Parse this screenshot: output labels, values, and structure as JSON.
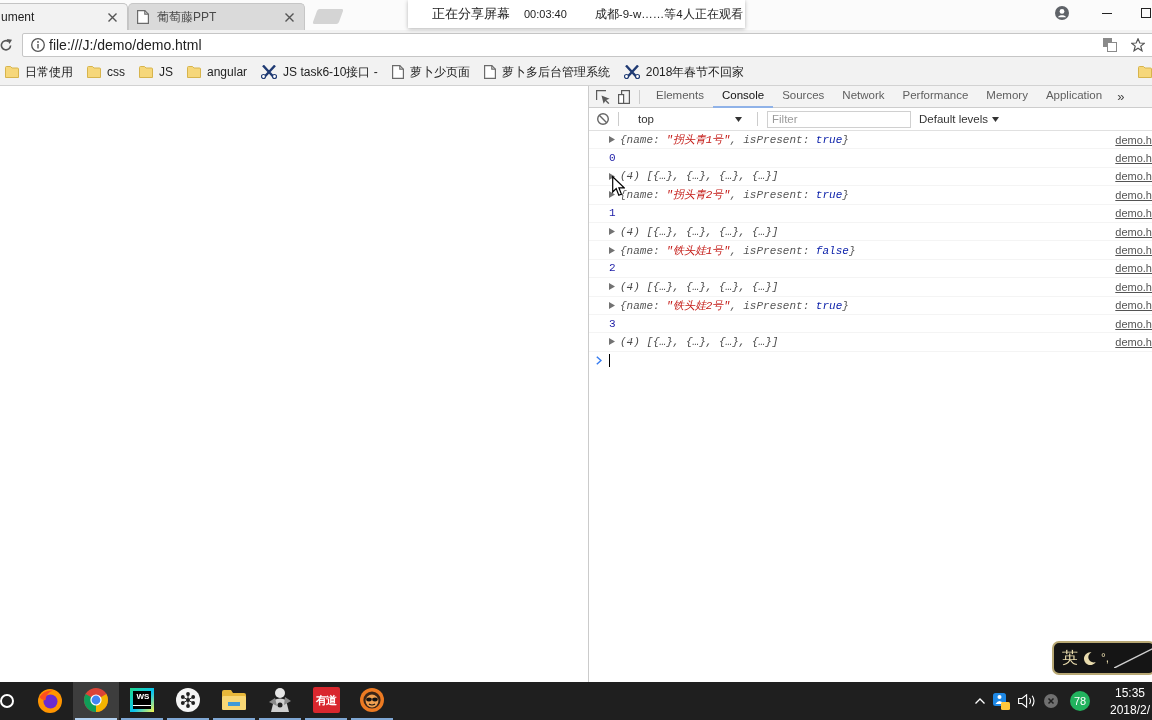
{
  "browser": {
    "tabs": [
      {
        "title": "ument",
        "selected": true
      },
      {
        "title": "葡萄藤PPT",
        "selected": false
      }
    ],
    "address_bar": {
      "value": "file:///J:/demo/demo.html"
    },
    "bookmarks": [
      {
        "kind": "folder",
        "label": "日常使用"
      },
      {
        "kind": "folder",
        "label": "css"
      },
      {
        "kind": "folder",
        "label": "JS"
      },
      {
        "kind": "folder",
        "label": "angular"
      },
      {
        "kind": "tool",
        "label": "JS task6-10接口 -"
      },
      {
        "kind": "page",
        "label": "萝卜少页面"
      },
      {
        "kind": "page",
        "label": "萝卜多后台管理系统"
      },
      {
        "kind": "tool",
        "label": "2018年春节不回家"
      }
    ]
  },
  "share_banner": {
    "status": "正在分享屏幕",
    "elapsed": "00:03:40",
    "viewers": "成都-9-w……等4人正在观看"
  },
  "devtools": {
    "tabs": [
      {
        "label": "Elements",
        "selected": false
      },
      {
        "label": "Console",
        "selected": true
      },
      {
        "label": "Sources",
        "selected": false
      },
      {
        "label": "Network",
        "selected": false
      },
      {
        "label": "Performance",
        "selected": false
      },
      {
        "label": "Memory",
        "selected": false
      },
      {
        "label": "Application",
        "selected": false
      }
    ],
    "more_tabs": "»",
    "console": {
      "context": "top",
      "filter": {
        "placeholder": "Filter"
      },
      "levels": "Default levels",
      "messages": [
        {
          "kind": "object",
          "segments": [
            {
              "kind": "punct",
              "text": "{name: "
            },
            {
              "kind": "string",
              "text": "\"拐头青1号\""
            },
            {
              "kind": "punct",
              "text": ", isPresent: "
            },
            {
              "kind": "boolean",
              "text": "true"
            },
            {
              "kind": "punct",
              "text": "}"
            }
          ],
          "source": "demo.h"
        },
        {
          "kind": "number",
          "segments": [
            {
              "kind": "number",
              "text": "0"
            }
          ],
          "source": "demo.h"
        },
        {
          "kind": "array",
          "segments": [
            {
              "kind": "preview",
              "text": "(4) [{…}, {…}, {…}, {…}]"
            }
          ],
          "source": "demo.h"
        },
        {
          "kind": "object",
          "segments": [
            {
              "kind": "punct",
              "text": "{name: "
            },
            {
              "kind": "string",
              "text": "\"拐头青2号\""
            },
            {
              "kind": "punct",
              "text": ", isPresent: "
            },
            {
              "kind": "boolean",
              "text": "true"
            },
            {
              "kind": "punct",
              "text": "}"
            }
          ],
          "source": "demo.h"
        },
        {
          "kind": "number",
          "segments": [
            {
              "kind": "number",
              "text": "1"
            }
          ],
          "source": "demo.h"
        },
        {
          "kind": "array",
          "segments": [
            {
              "kind": "preview",
              "text": "(4) [{…}, {…}, {…}, {…}]"
            }
          ],
          "source": "demo.h"
        },
        {
          "kind": "object",
          "segments": [
            {
              "kind": "punct",
              "text": "{name: "
            },
            {
              "kind": "string",
              "text": "\"铁头娃1号\""
            },
            {
              "kind": "punct",
              "text": ", isPresent: "
            },
            {
              "kind": "boolean",
              "text": "false"
            },
            {
              "kind": "punct",
              "text": "}"
            }
          ],
          "source": "demo.h"
        },
        {
          "kind": "number",
          "segments": [
            {
              "kind": "number",
              "text": "2"
            }
          ],
          "source": "demo.h"
        },
        {
          "kind": "array",
          "segments": [
            {
              "kind": "preview",
              "text": "(4) [{…}, {…}, {…}, {…}]"
            }
          ],
          "source": "demo.h"
        },
        {
          "kind": "object",
          "segments": [
            {
              "kind": "punct",
              "text": "{name: "
            },
            {
              "kind": "string",
              "text": "\"铁头娃2号\""
            },
            {
              "kind": "punct",
              "text": ", isPresent: "
            },
            {
              "kind": "boolean",
              "text": "true"
            },
            {
              "kind": "punct",
              "text": "}"
            }
          ],
          "source": "demo.h"
        },
        {
          "kind": "number",
          "segments": [
            {
              "kind": "number",
              "text": "3"
            }
          ],
          "source": "demo.h"
        },
        {
          "kind": "array",
          "segments": [
            {
              "kind": "preview",
              "text": "(4) [{…}, {…}, {…}, {…}]"
            }
          ],
          "source": "demo.h"
        }
      ]
    }
  },
  "ime": {
    "mode": "英",
    "punctuation": "°,"
  },
  "taskbar": {
    "apps": [
      {
        "kind": "globe",
        "running": false,
        "selected": false
      },
      {
        "kind": "ring_logo",
        "running": true,
        "selected": true
      },
      {
        "kind": "framed_tile",
        "label": "WS",
        "running": true,
        "selected": false
      },
      {
        "kind": "dots",
        "running": true,
        "selected": false
      },
      {
        "kind": "folder",
        "running": true,
        "selected": false
      },
      {
        "kind": "figure",
        "running": true,
        "selected": false
      },
      {
        "kind": "flat_tile",
        "label": "有道",
        "running": true,
        "selected": false
      },
      {
        "kind": "face",
        "running": true,
        "selected": false
      }
    ],
    "tray": {
      "badge": "78"
    },
    "time": "15:35",
    "date": "2018/2/"
  }
}
